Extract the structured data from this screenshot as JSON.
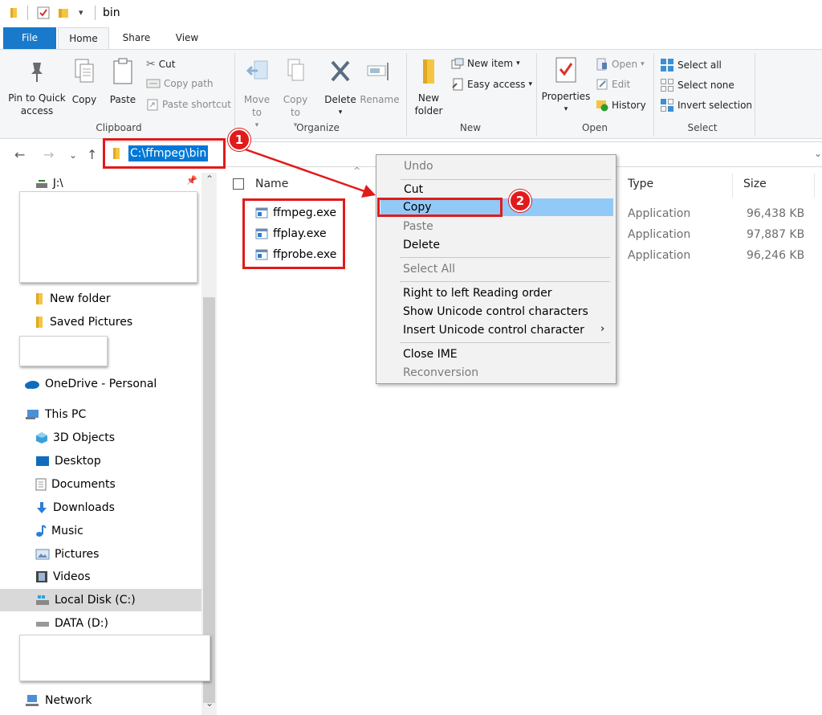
{
  "window": {
    "title": "bin"
  },
  "tabs": [
    "File",
    "Home",
    "Share",
    "View"
  ],
  "ribbon": {
    "clipboard": {
      "label": "Clipboard",
      "pin": "Pin to Quick access",
      "copy": "Copy",
      "paste": "Paste",
      "cut": "Cut",
      "copy_path": "Copy path",
      "paste_shortcut": "Paste shortcut"
    },
    "organize": {
      "label": "Organize",
      "move_to": "Move to",
      "copy_to": "Copy to",
      "delete": "Delete",
      "rename": "Rename"
    },
    "new": {
      "label": "New",
      "new_folder": "New folder",
      "new_item": "New item",
      "easy_access": "Easy access"
    },
    "open": {
      "label": "Open",
      "properties": "Properties",
      "open": "Open",
      "edit": "Edit",
      "history": "History"
    },
    "select": {
      "label": "Select",
      "select_all": "Select all",
      "select_none": "Select none",
      "invert": "Invert selection"
    }
  },
  "address": {
    "path": "C:\\ffmpeg\\bin"
  },
  "nav_pane": {
    "drive_j": "J:\\",
    "new_folder": "New folder",
    "saved_pictures": "Saved Pictures",
    "onedrive": "OneDrive - Personal",
    "this_pc": "This PC",
    "objects3d": "3D Objects",
    "desktop": "Desktop",
    "documents": "Documents",
    "downloads": "Downloads",
    "music": "Music",
    "pictures": "Pictures",
    "videos": "Videos",
    "local_disk": "Local Disk (C:)",
    "data_d": "DATA (D:)",
    "network": "Network"
  },
  "columns": {
    "name": "Name",
    "type": "Type",
    "size": "Size"
  },
  "files": [
    {
      "name": "ffmpeg.exe",
      "type": "Application",
      "size": "96,438 KB"
    },
    {
      "name": "ffplay.exe",
      "type": "Application",
      "size": "97,887 KB"
    },
    {
      "name": "ffprobe.exe",
      "type": "Application",
      "size": "96,246 KB"
    }
  ],
  "context_menu": {
    "undo": "Undo",
    "cut": "Cut",
    "copy": "Copy",
    "paste": "Paste",
    "delete": "Delete",
    "select_all": "Select All",
    "rtl": "Right to left Reading order",
    "show_unicode": "Show Unicode control characters",
    "insert_unicode": "Insert Unicode control character",
    "close_ime": "Close IME",
    "reconversion": "Reconversion"
  },
  "annotations": {
    "step1": "1",
    "step2": "2"
  },
  "colors": {
    "accent": "#0078d7",
    "annotation_red": "#e21a1a",
    "file_tab": "#1979ca",
    "menu_highlight": "#91c9f7"
  }
}
